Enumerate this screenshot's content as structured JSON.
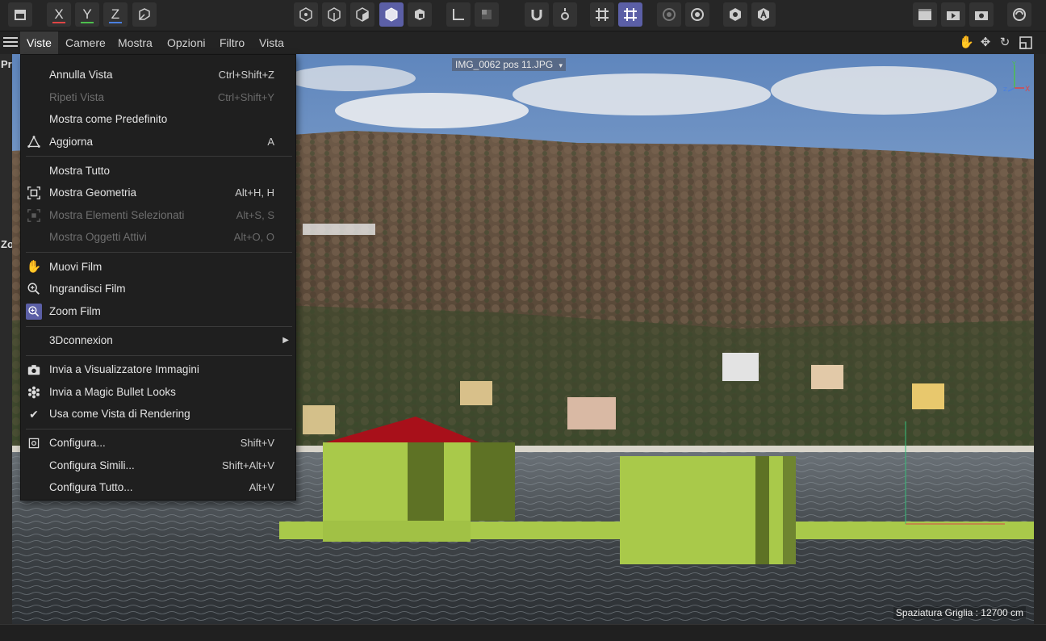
{
  "toolbar": {
    "axis_x": "X",
    "axis_y": "Y",
    "axis_z": "Z",
    "color_x": "#e04545",
    "color_y": "#4dbf4d",
    "color_z": "#4a7fe0",
    "accent": "#5b5fa6"
  },
  "viewport_menu": {
    "items": [
      "Viste",
      "Camere",
      "Mostra",
      "Opzioni",
      "Filtro",
      "Vista"
    ]
  },
  "left_strip": {
    "label_top": "Pr",
    "label_mid": "Zoo"
  },
  "viewport": {
    "image_label": "IMG_0062 pos 11.JPG",
    "grid_spacing": "Spaziatura Griglia : 12700 cm"
  },
  "dropdown": {
    "items": [
      {
        "label": "Annulla Vista",
        "shortcut": "Ctrl+Shift+Z"
      },
      {
        "label": "Ripeti Vista",
        "shortcut": "Ctrl+Shift+Y"
      },
      {
        "label": "Mostra come Predefinito",
        "shortcut": ""
      },
      {
        "label": "Aggiorna",
        "shortcut": "A"
      },
      {
        "label": "Mostra Tutto",
        "shortcut": ""
      },
      {
        "label": "Mostra Geometria",
        "shortcut": "Alt+H, H"
      },
      {
        "label": "Mostra Elementi Selezionati",
        "shortcut": "Alt+S, S"
      },
      {
        "label": "Mostra Oggetti Attivi",
        "shortcut": "Alt+O, O"
      },
      {
        "label": "Muovi Film",
        "shortcut": ""
      },
      {
        "label": "Ingrandisci Film",
        "shortcut": ""
      },
      {
        "label": "Zoom Film",
        "shortcut": ""
      },
      {
        "label": "3Dconnexion",
        "shortcut": ""
      },
      {
        "label": "Invia a Visualizzatore Immagini",
        "shortcut": ""
      },
      {
        "label": "Invia a Magic Bullet Looks",
        "shortcut": ""
      },
      {
        "label": "Usa come Vista di Rendering",
        "shortcut": ""
      },
      {
        "label": "Configura...",
        "shortcut": "Shift+V"
      },
      {
        "label": "Configura Simili...",
        "shortcut": "Shift+Alt+V"
      },
      {
        "label": "Configura Tutto...",
        "shortcut": "Alt+V"
      }
    ]
  }
}
